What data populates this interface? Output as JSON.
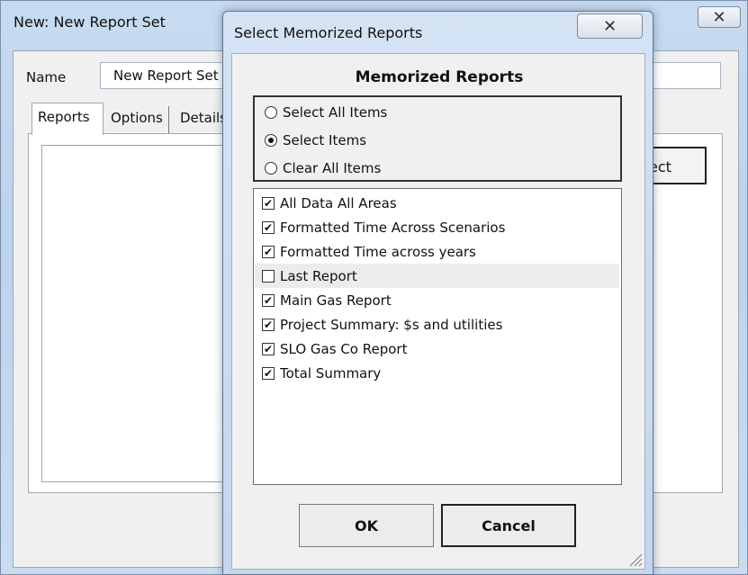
{
  "background_window": {
    "title": "New: New Report Set",
    "close_glyph": "✕",
    "name_label": "Name",
    "name_value": "New Report Set",
    "tabs": [
      {
        "label": "Reports"
      },
      {
        "label": "Options"
      },
      {
        "label": "Details"
      }
    ],
    "select_button_label": "ect"
  },
  "dialog": {
    "title": "Select Memorized Reports",
    "close_glyph": "✕",
    "heading": "Memorized Reports",
    "radio_options": [
      {
        "label": "Select All Items",
        "selected": false
      },
      {
        "label": "Select Items",
        "selected": true
      },
      {
        "label": "Clear All Items",
        "selected": false
      }
    ],
    "reports": [
      {
        "label": "All Data All Areas",
        "checked": true
      },
      {
        "label": "Formatted Time Across Scenarios",
        "checked": true
      },
      {
        "label": "Formatted Time across years",
        "checked": true
      },
      {
        "label": "Last Report",
        "checked": false
      },
      {
        "label": "Main Gas Report",
        "checked": true
      },
      {
        "label": "Project Summary: $s and utilities",
        "checked": true
      },
      {
        "label": "SLO Gas Co Report",
        "checked": true
      },
      {
        "label": "Total Summary",
        "checked": true
      }
    ],
    "ok_label": "OK",
    "cancel_label": "Cancel",
    "check_glyph": "✔"
  }
}
